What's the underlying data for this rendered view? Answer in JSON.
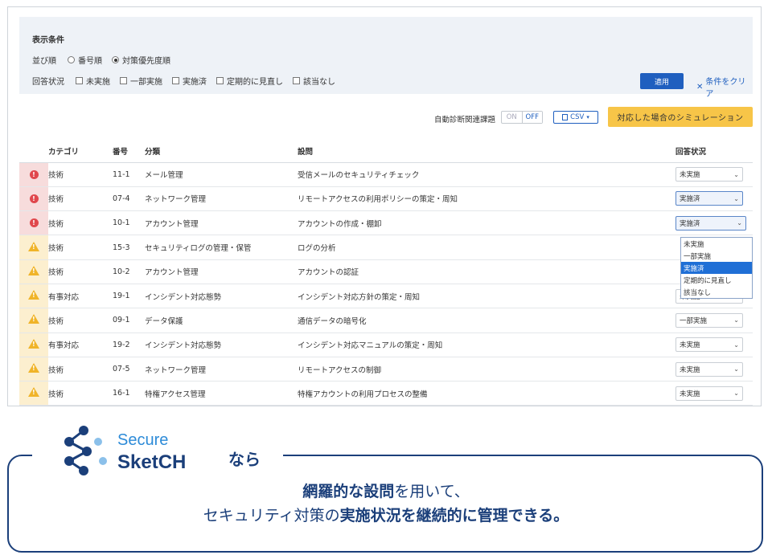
{
  "filter": {
    "title": "表示条件",
    "sort_label": "並び順",
    "sort_options": [
      "番号順",
      "対策優先度順"
    ],
    "status_label": "回答状況",
    "status_options": [
      "未実施",
      "一部実施",
      "実施済",
      "定期的に見直し",
      "該当なし"
    ],
    "apply": "適用",
    "clear": "条件をクリア"
  },
  "toolbar": {
    "auto_label": "自動診断関連課題",
    "toggle_on": "ON",
    "toggle_off": "OFF",
    "csv": "CSV",
    "simulate": "対応した場合のシミュレーション"
  },
  "table": {
    "headers": [
      "カテゴリ",
      "番号",
      "分類",
      "設問",
      "回答状況"
    ],
    "rows": [
      {
        "level": "high",
        "category": "技術",
        "number": "11-1",
        "class": "メール管理",
        "question": "受信メールのセキュリティチェック",
        "status": "未実施"
      },
      {
        "level": "high",
        "category": "技術",
        "number": "07-4",
        "class": "ネットワーク管理",
        "question": "リモートアクセスの利用ポリシーの策定・周知",
        "status": "実施済"
      },
      {
        "level": "high",
        "category": "技術",
        "number": "10-1",
        "class": "アカウント管理",
        "question": "アカウントの作成・棚卸",
        "status": "実施済"
      },
      {
        "level": "mid",
        "category": "技術",
        "number": "15-3",
        "class": "セキュリティログの管理・保管",
        "question": "ログの分析",
        "status": ""
      },
      {
        "level": "mid",
        "category": "技術",
        "number": "10-2",
        "class": "アカウント管理",
        "question": "アカウントの認証",
        "status": ""
      },
      {
        "level": "mid",
        "category": "有事対応",
        "number": "19-1",
        "class": "インシデント対応態勢",
        "question": "インシデント対応方針の策定・周知",
        "status": "未実施"
      },
      {
        "level": "mid",
        "category": "技術",
        "number": "09-1",
        "class": "データ保護",
        "question": "通信データの暗号化",
        "status": "一部実施"
      },
      {
        "level": "mid",
        "category": "有事対応",
        "number": "19-2",
        "class": "インシデント対応態勢",
        "question": "インシデント対応マニュアルの策定・周知",
        "status": "未実施"
      },
      {
        "level": "mid",
        "category": "技術",
        "number": "07-5",
        "class": "ネットワーク管理",
        "question": "リモートアクセスの制御",
        "status": "未実施"
      },
      {
        "level": "mid",
        "category": "技術",
        "number": "16-1",
        "class": "特権アクセス管理",
        "question": "特権アカウントの利用プロセスの整備",
        "status": "未実施"
      }
    ]
  },
  "dropdown": {
    "options": [
      "未実施",
      "一部実施",
      "実施済",
      "定期的に見直し",
      "該当なし"
    ],
    "selected": "実施済"
  },
  "brand": {
    "secure": "Secure",
    "sketch": "SketCH",
    "nara": "なら"
  },
  "caption": {
    "l1_bold": "網羅的な設問",
    "l1_rest": "を用いて、",
    "l2_a": "セキュリティ対策の",
    "l2_bold": "実施状況を継続的に管理できる。"
  },
  "colors": {
    "accent": "#1f5fbf",
    "simulate_bg": "#f7c548",
    "high_risk": "#e0474c",
    "mid_risk": "#f0b429",
    "brand_dark": "#1b3f7a",
    "brand_light": "#2d8bd8"
  }
}
